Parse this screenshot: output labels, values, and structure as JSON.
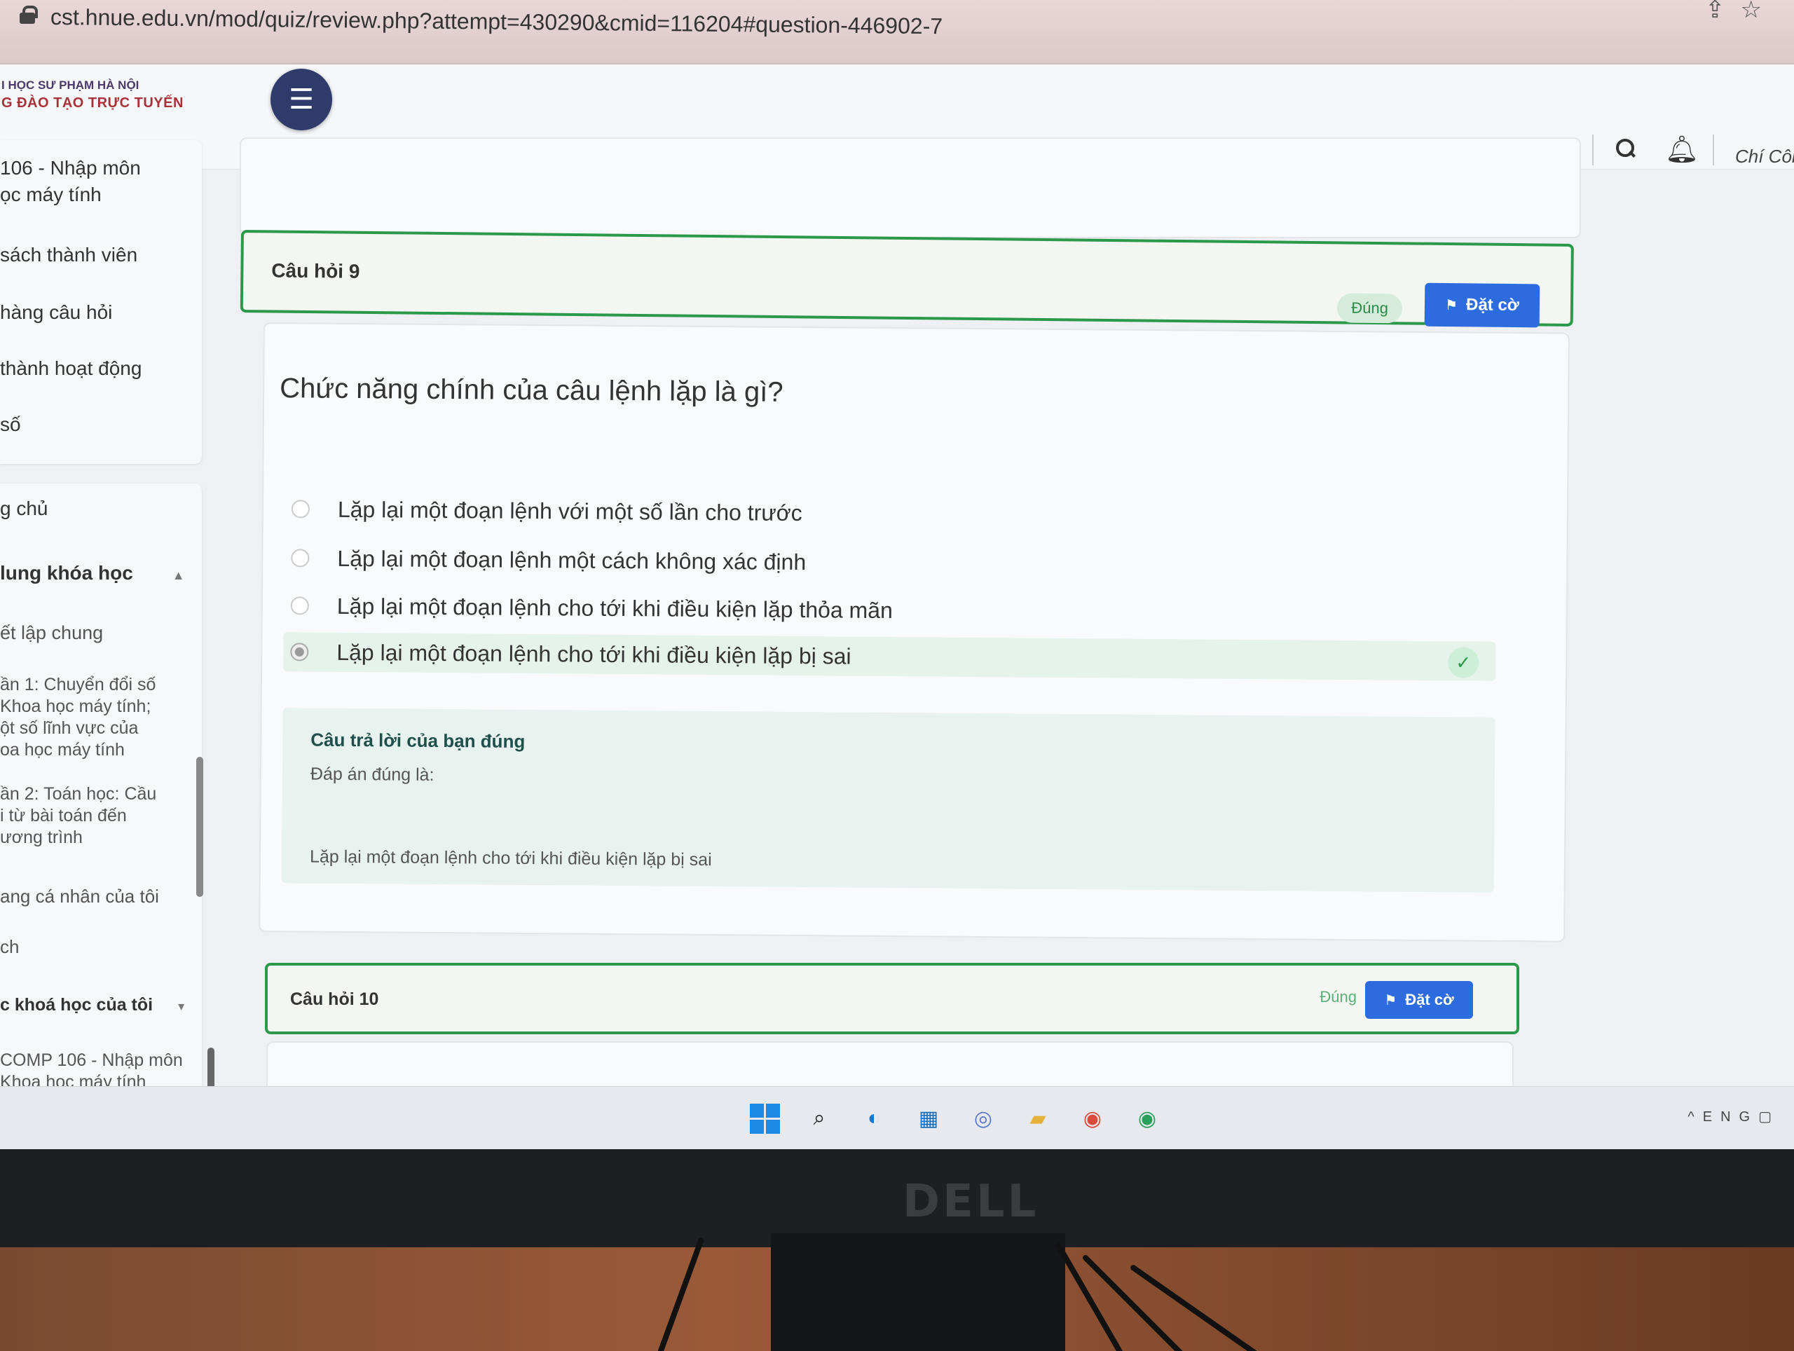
{
  "browser": {
    "url": "cst.hnue.edu.vn/mod/quiz/review.php?attempt=430290&cmid=116204#question-446902-7",
    "icons": [
      "share-icon",
      "star-icon"
    ]
  },
  "header": {
    "logo_line1": "I HỌC SƯ PHẠM HÀ NỘI",
    "logo_line2": "G ĐÀO TẠO TRỰC TUYẾN",
    "user_name": "Chí Côn"
  },
  "sidebar": {
    "course_title_1": "106 - Nhập môn",
    "course_title_2": "ọc máy tính",
    "items": [
      "sách thành viên",
      "hàng câu hỏi",
      "thành hoạt động",
      "số"
    ],
    "home": "g chủ",
    "course_content": "lung khóa học",
    "general": "ết lập chung",
    "topic1": [
      "ần 1: Chuyển đổi số",
      " Khoa học máy tính;",
      "ột số lĩnh vực của",
      "oa học máy tính"
    ],
    "topic2": [
      "ần 2: Toán học: Cầu",
      "i từ bài toán đến",
      "ương trình"
    ],
    "personal": "ang cá nhân của tôi",
    "calendar": "ch",
    "my_courses": "c khoá học của tôi",
    "course_link": [
      "COMP 106 - Nhập môn",
      "Khoa học máy tính"
    ]
  },
  "question9": {
    "title": "Câu hỏi 9",
    "status": "Đúng",
    "flag_label": "Đặt cờ",
    "text": "Chức năng chính của câu lệnh lặp là gì?",
    "options": [
      "Lặp lại một đoạn lệnh với một số lần cho trước",
      "Lặp lại một đoạn lệnh một cách không xác định",
      "Lặp lại một đoạn lệnh cho tới khi điều kiện lặp thỏa mãn",
      "Lặp lại một đoạn lệnh cho tới khi điều kiện lặp bị sai"
    ],
    "selected_index": 3,
    "feedback_title": "Câu trả lời của bạn đúng",
    "feedback_label": "Đáp án đúng là:",
    "feedback_answer": "Lặp lại một đoạn lệnh cho tới khi điều kiện lặp bị sai"
  },
  "question10": {
    "title": "Câu hỏi 10",
    "status": "Đúng",
    "flag_label": "Đặt cờ"
  },
  "taskbar": {
    "apps": [
      "start-icon",
      "search-icon",
      "edge-icon",
      "store-icon",
      "teams-icon",
      "explorer-icon",
      "chrome-icon",
      "chrome-alt-icon"
    ],
    "tray_text": "ENG"
  },
  "monitor": {
    "brand": "DELL"
  }
}
